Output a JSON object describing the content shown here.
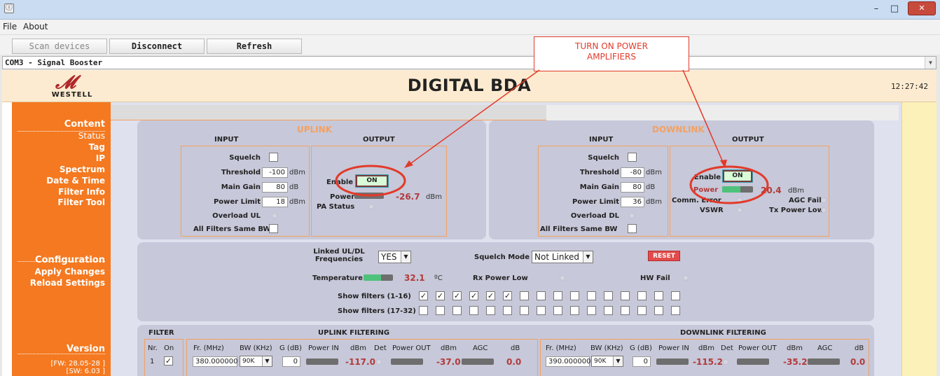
{
  "window": {
    "minimize_glyph": "–",
    "restore_glyph": "□",
    "close_glyph": "✕"
  },
  "menu": {
    "file": "File",
    "about": "About"
  },
  "toolbar": {
    "scan": "Scan devices",
    "disconnect": "Disconnect",
    "refresh": "Refresh"
  },
  "device_combo": {
    "value": "COM3 - Signal Booster"
  },
  "header": {
    "logo_text": "WESTELL",
    "title": "DIGITAL BDA",
    "clock": "12:27:42"
  },
  "sidebar": {
    "content_head": "Content",
    "content_items": [
      "Status",
      "Tag",
      "IP",
      "Spectrum",
      "Date & Time",
      "Filter Info",
      "Filter Tool"
    ],
    "config_head": "Configuration",
    "config_items": [
      "Apply Changes",
      "Reload Settings"
    ],
    "version_head": "Version",
    "fw": "[FW: 28.05-28 ]",
    "sw": "[SW: 6.03 ]"
  },
  "uplink": {
    "title": "UPLINK",
    "input_head": "INPUT",
    "output_head": "OUTPUT",
    "squelch_label": "Squelch",
    "threshold_label": "Threshold",
    "threshold_value": "-100",
    "threshold_unit": "dBm",
    "main_gain_label": "Main Gain",
    "main_gain_value": "80",
    "main_gain_unit": "dB",
    "power_limit_label": "Power Limit",
    "power_limit_value": "18",
    "power_limit_unit": "dBm",
    "overload_label": "Overload UL",
    "same_bw_label": "All Filters Same BW",
    "enable_label": "Enable",
    "enable_value": "ON",
    "power_label": "Power",
    "power_value": "-26.7",
    "power_unit": "dBm",
    "pa_status_label": "PA Status"
  },
  "downlink": {
    "title": "DOWNLINK",
    "input_head": "INPUT",
    "output_head": "OUTPUT",
    "squelch_label": "Squelch",
    "threshold_label": "Threshold",
    "threshold_value": "-80",
    "threshold_unit": "dBm",
    "main_gain_label": "Main Gain",
    "main_gain_value": "80",
    "main_gain_unit": "dB",
    "power_limit_label": "Power Limit",
    "power_limit_value": "36",
    "power_limit_unit": "dBm",
    "overload_label": "Overload DL",
    "same_bw_label": "All Filters Same BW",
    "enable_label": "Enable",
    "enable_value": "ON",
    "power_label": "Power",
    "power_value": "20.4",
    "power_unit": "dBm",
    "power_fill": 0.6,
    "comm_error_label": "Comm. Error",
    "agc_fail_label": "AGC Fail",
    "vswr_label": "VSWR",
    "tx_power_low_label": "Tx Power Low"
  },
  "config": {
    "linked_label_1": "Linked UL/DL",
    "linked_label_2": "Frequencies",
    "linked_value": "YES",
    "squelch_mode_label": "Squelch Mode",
    "squelch_mode_value": "Not Linked",
    "reset_label": "RESET",
    "temperature_label": "Temperature",
    "temperature_value": "32.1",
    "temperature_unit": "ºC",
    "temperature_fill": 0.6,
    "rx_power_low_label": "Rx Power Low",
    "hw_fail_label": "HW Fail",
    "show_filters_1_label": "Show filters (1-16)",
    "show_filters_1_checked": [
      true,
      true,
      true,
      true,
      true,
      true,
      false,
      false,
      false,
      false,
      false,
      false,
      false,
      false,
      false,
      false
    ],
    "show_filters_2_label": "Show filters (17-32)",
    "show_filters_2_checked": [
      false,
      false,
      false,
      false,
      false,
      false,
      false,
      false,
      false,
      false,
      false,
      false,
      false,
      false,
      false,
      false
    ]
  },
  "filters": {
    "filter_head": "FILTER",
    "uplink_head": "UPLINK FILTERING",
    "downlink_head": "DOWNLINK FILTERING",
    "nr_head": "Nr.",
    "on_head": "On",
    "fr_head": "Fr. (MHz)",
    "bw_head": "BW (KHz)",
    "g_head": "G (dB)",
    "power_in_head": "Power IN",
    "dbm_head": "dBm",
    "det_head": "Det",
    "power_out_head": "Power OUT",
    "agc_head": "AGC",
    "db_head": "dB",
    "row1": {
      "nr": "1",
      "on": true,
      "ul_freq": "380.000000",
      "ul_bw": "90K",
      "ul_gain": "0",
      "ul_power_in": "-117.0",
      "ul_power_out": "-37.0",
      "ul_agc": "0.0",
      "dl_freq": "390.000000",
      "dl_bw": "90K",
      "dl_gain": "0",
      "dl_power_in": "-115.2",
      "dl_power_out": "-35.2",
      "dl_agc": "0.0"
    }
  },
  "annotation": {
    "line1": "TURN ON POWER",
    "line2": "AMPLIFIERS",
    "color": "#e23a2a"
  }
}
